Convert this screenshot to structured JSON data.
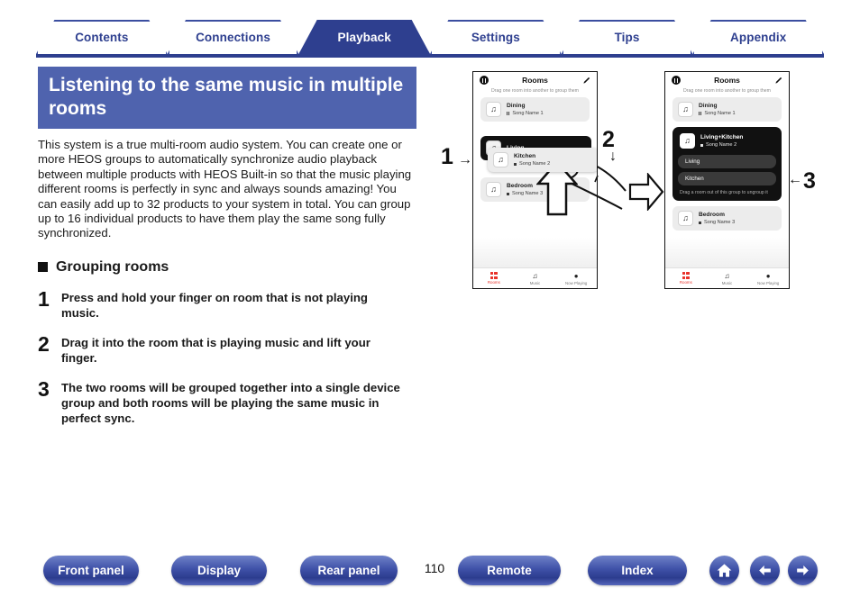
{
  "nav": {
    "tabs": [
      {
        "label": "Contents",
        "active": false
      },
      {
        "label": "Connections",
        "active": false
      },
      {
        "label": "Playback",
        "active": true
      },
      {
        "label": "Settings",
        "active": false
      },
      {
        "label": "Tips",
        "active": false
      },
      {
        "label": "Appendix",
        "active": false
      }
    ]
  },
  "page": {
    "title": "Listening to the same music in multiple rooms",
    "intro": "This system is a true multi-room audio system. You can create one or more HEOS groups to automatically synchronize audio playback between multiple products with HEOS Built-in so that the music playing different rooms is perfectly in sync and always sounds amazing! You can easily add up to 32 products to your system in total. You can group up to 16 individual products to have them play the same song fully synchronized.",
    "section_heading": "Grouping rooms",
    "steps": [
      {
        "num": "1",
        "text": "Press and hold your finger on room that is not playing music."
      },
      {
        "num": "2",
        "text": "Drag it into the room that is playing music and lift your finger."
      },
      {
        "num": "3",
        "text": "The two rooms will be grouped together into a single device group and both rooms will be playing the same music in perfect sync."
      }
    ],
    "page_number": "110"
  },
  "annotations": {
    "step1": "1",
    "step1_arrow": "→",
    "step2": "2",
    "step2_arrow": "↓",
    "step3": "3",
    "step3_arrow": "←"
  },
  "phone1": {
    "header_title": "Rooms",
    "subtitle": "Drag one room into another to group them",
    "logo_icon": "heos-logo-icon",
    "edit_icon": "pencil-icon",
    "rooms": [
      {
        "name": "Dining",
        "song": "Song Name 1",
        "state": "paused",
        "icon": "music-note-icon"
      },
      {
        "name": "Bedroom",
        "song": "Song Name 3",
        "state": "playing",
        "icon": "music-note-icon"
      }
    ],
    "dragging": {
      "target_room": {
        "name": "Living",
        "song": "",
        "icon": "music-note-icon"
      },
      "dragged_room": {
        "name": "Kitchen",
        "song": "Song Name 2",
        "state": "playing",
        "icon": "music-note-icon"
      }
    },
    "tabbar": [
      {
        "label": "Rooms",
        "icon": "rooms-grid-icon",
        "active": true
      },
      {
        "label": "Music",
        "icon": "music-note-icon",
        "active": false
      },
      {
        "label": "Now Playing",
        "icon": "now-playing-icon",
        "active": false
      }
    ]
  },
  "phone2": {
    "header_title": "Rooms",
    "subtitle": "Drag one room into another to group them",
    "logo_icon": "heos-logo-icon",
    "edit_icon": "pencil-icon",
    "rooms_before": [
      {
        "name": "Dining",
        "song": "Song Name 1",
        "state": "paused",
        "icon": "music-note-icon"
      }
    ],
    "group": {
      "name": "Living+Kitchen",
      "song": "Song Name 2",
      "state": "playing",
      "icon": "music-note-icon",
      "members": [
        "Living",
        "Kitchen"
      ],
      "hint": "Drag a room out of this group to ungroup it"
    },
    "rooms_after": [
      {
        "name": "Bedroom",
        "song": "Song Name 3",
        "state": "playing",
        "icon": "music-note-icon"
      }
    ],
    "tabbar": [
      {
        "label": "Rooms",
        "icon": "rooms-grid-icon",
        "active": true
      },
      {
        "label": "Music",
        "icon": "music-note-icon",
        "active": false
      },
      {
        "label": "Now Playing",
        "icon": "now-playing-icon",
        "active": false
      }
    ]
  },
  "footer": {
    "buttons": [
      {
        "label": "Front panel"
      },
      {
        "label": "Display"
      },
      {
        "label": "Rear panel"
      },
      {
        "label": "Remote"
      },
      {
        "label": "Index"
      }
    ],
    "icons": [
      {
        "name": "home-icon"
      },
      {
        "name": "arrow-left-icon"
      },
      {
        "name": "arrow-right-icon"
      }
    ]
  },
  "colors": {
    "accent_blue": "#2e3f8f",
    "title_banner": "#4f63ae",
    "active_tab_red": "#e8322a"
  }
}
